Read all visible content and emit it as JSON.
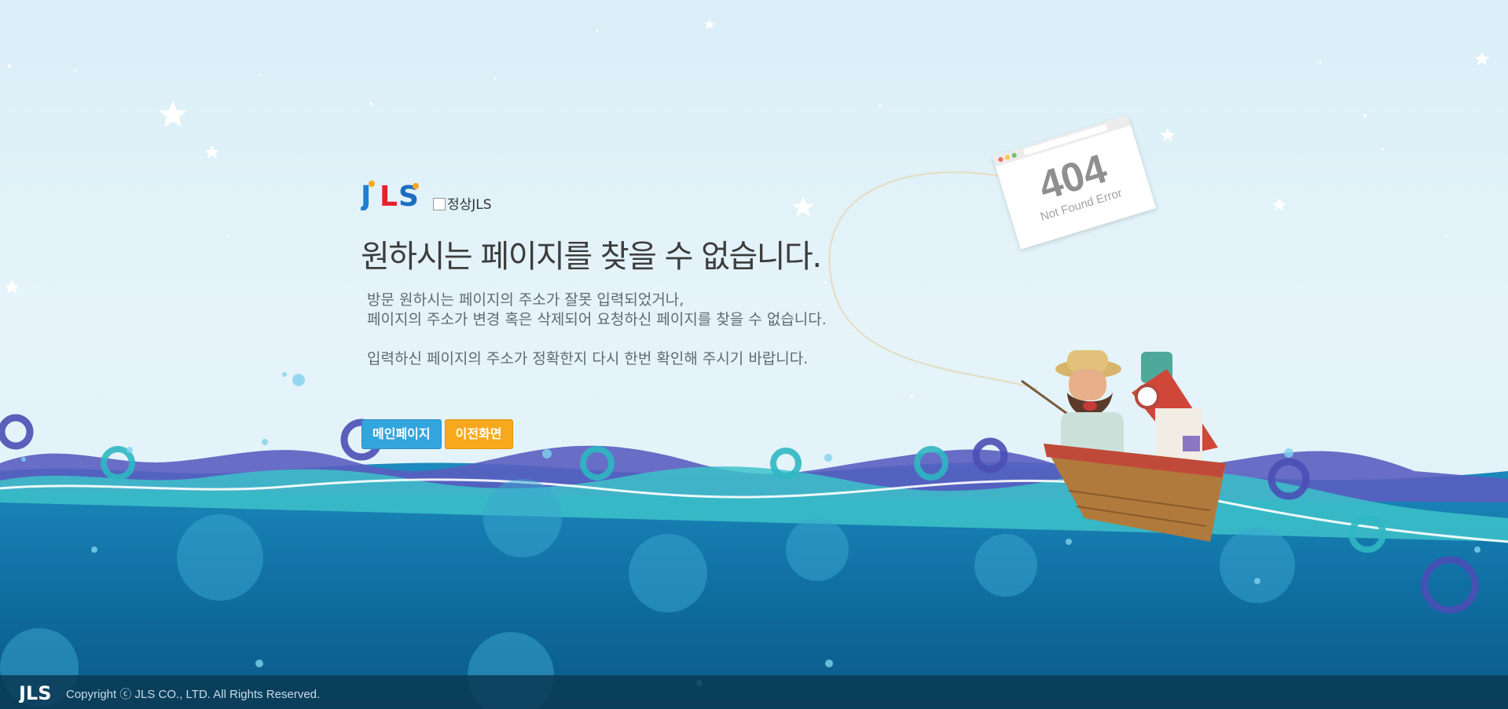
{
  "brand": {
    "logo_text": "JLS",
    "logo_alt": "정상JLS",
    "colors": {
      "j": "#1f7fd1",
      "l": "#e4222c",
      "s": "#1a6ec0",
      "dot": "#f7a81b"
    }
  },
  "main": {
    "title": "원하시는 페이지를 찾을 수 없습니다.",
    "desc_lines": [
      "방문 원하시는 페이지의 주소가 잘못 입력되었거나,",
      "페이지의 주소가 변경 혹은 삭제되어 요청하신 페이지를 찾을 수 없습니다.",
      "입력하신 페이지의 주소가 정확한지 다시 한번 확인해 주시기 바랍니다."
    ],
    "buttons": {
      "main_label": "메인페이지",
      "prev_label": "이전화면"
    }
  },
  "error_card": {
    "code": "404",
    "subtitle": "Not Found Error"
  },
  "footer": {
    "logo_text": "JLS",
    "copyright": "Copyright ⓒ JLS CO., LTD. All Rights Reserved."
  },
  "icons": [
    "jls-logo-icon",
    "broken-image-icon",
    "star-icon",
    "fisherman-illustration",
    "boat-icon",
    "wave-icon"
  ],
  "theme": {
    "sky": "#dff0f7",
    "sea_dark": "#0b5f8d",
    "sea_light": "#2a95c2",
    "wave_purple": "#5a5ec0",
    "wave_teal": "#3dc2c9",
    "button_blue": "#33a5dd",
    "button_orange": "#f7a81b",
    "footer_bg": "#0a3a54"
  }
}
